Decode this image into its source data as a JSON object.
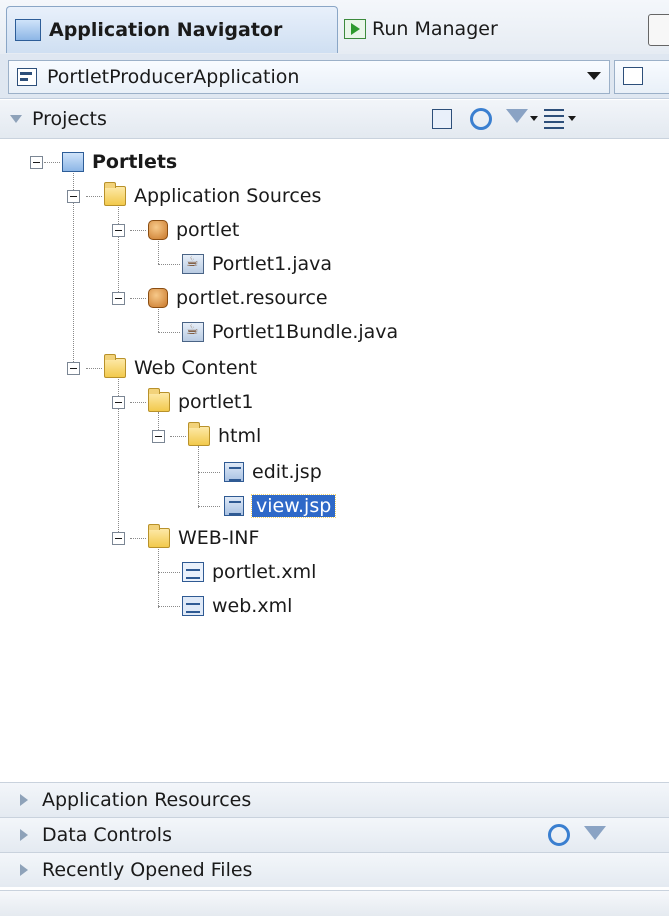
{
  "tabs": {
    "app_navigator": "Application Navigator",
    "run_manager": "Run Manager"
  },
  "app_selector": {
    "value": "PortletProducerApplication"
  },
  "projects": {
    "header": "Projects"
  },
  "tree": {
    "portlets": "Portlets",
    "application_sources": "Application Sources",
    "portlet_pkg": "portlet",
    "portlet1_java": "Portlet1.java",
    "portlet_resource_pkg": "portlet.resource",
    "portlet1bundle_java": "Portlet1Bundle.java",
    "web_content": "Web Content",
    "portlet1_folder": "portlet1",
    "html_folder": "html",
    "edit_jsp": "edit.jsp",
    "view_jsp": "view.jsp",
    "web_inf": "WEB-INF",
    "portlet_xml": "portlet.xml",
    "web_xml": "web.xml"
  },
  "accordion": {
    "application_resources": "Application Resources",
    "data_controls": "Data Controls",
    "recently_opened": "Recently Opened Files"
  },
  "colors": {
    "selection": "#2f69c8",
    "accent": "#8aa6c6"
  }
}
